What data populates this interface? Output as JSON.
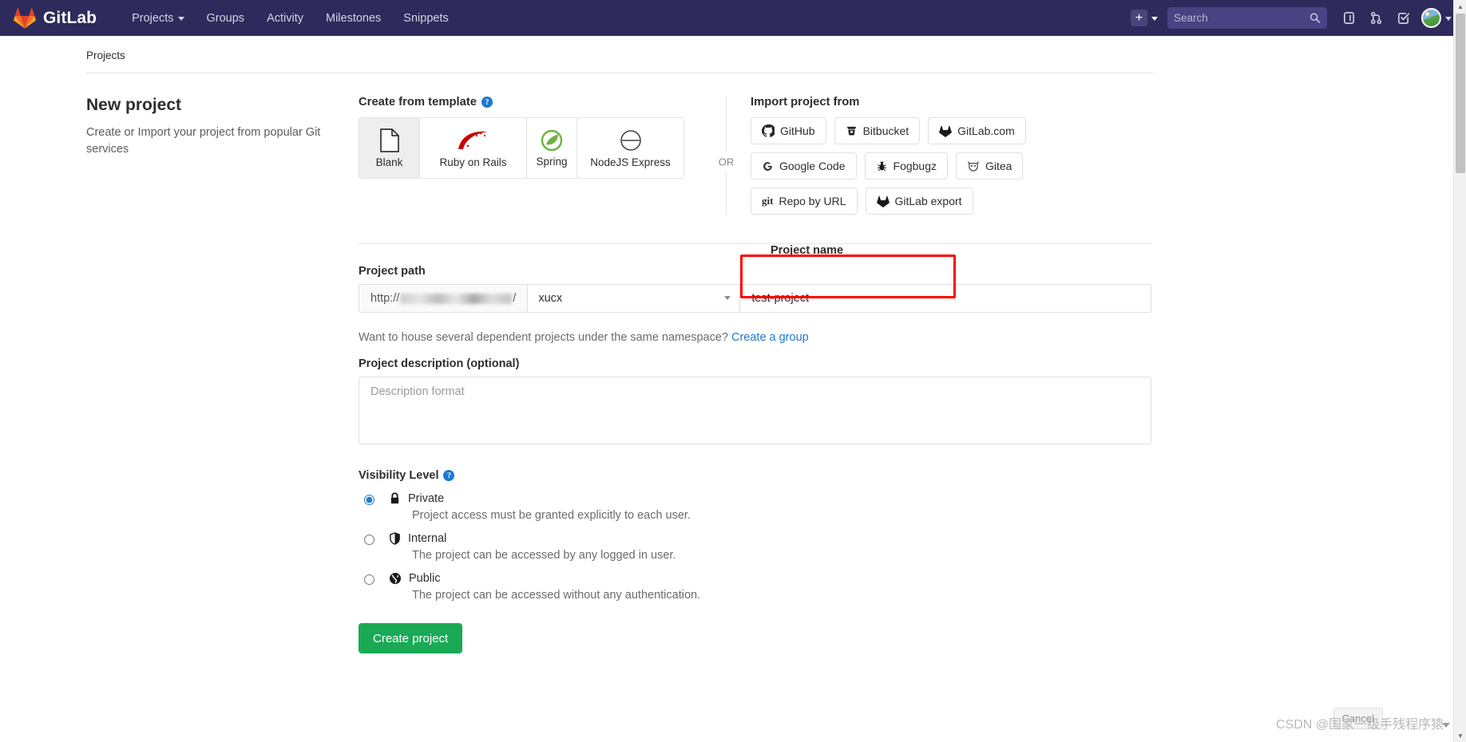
{
  "navbar": {
    "brand": "GitLab",
    "logo_icon": "gitlab-fox-logo",
    "links": [
      {
        "label": "Projects",
        "has_caret": true
      },
      {
        "label": "Groups",
        "has_caret": false
      },
      {
        "label": "Activity",
        "has_caret": false
      },
      {
        "label": "Milestones",
        "has_caret": false
      },
      {
        "label": "Snippets",
        "has_caret": false
      }
    ],
    "plus_label": "+",
    "search_placeholder": "Search",
    "search_value": "",
    "icons": [
      "issues-icon",
      "merge-requests-icon",
      "todos-icon"
    ],
    "avatar_icon": "user-avatar"
  },
  "breadcrumb": {
    "items": [
      "Projects"
    ]
  },
  "left": {
    "title": "New project",
    "subtitle": "Create or Import your project from popular Git services"
  },
  "templates": {
    "section_title": "Create from template",
    "help_icon": "?",
    "items": [
      {
        "label": "Blank",
        "icon": "blank-file-icon",
        "selected": true
      },
      {
        "label": "Ruby on Rails",
        "icon": "rails-icon",
        "selected": false
      },
      {
        "label": "Spring",
        "icon": "spring-leaf-icon",
        "selected": false
      },
      {
        "label": "NodeJS Express",
        "icon": "express-icon",
        "selected": false
      }
    ]
  },
  "or_divider": "OR",
  "import": {
    "section_title": "Import project from",
    "buttons": [
      {
        "label": "GitHub",
        "icon": "github-icon"
      },
      {
        "label": "Bitbucket",
        "icon": "bitbucket-icon"
      },
      {
        "label": "GitLab.com",
        "icon": "gitlab-icon"
      },
      {
        "label": "Google Code",
        "icon": "google-icon"
      },
      {
        "label": "Fogbugz",
        "icon": "fogbugz-bug-icon"
      },
      {
        "label": "Gitea",
        "icon": "gitea-icon"
      },
      {
        "label": "Repo by URL",
        "icon": "git-text-icon"
      },
      {
        "label": "GitLab export",
        "icon": "gitlab-icon"
      }
    ]
  },
  "form": {
    "path_label": "Project path",
    "path_prefix_scheme": "http://",
    "path_prefix_suffix": "/",
    "namespace_value": "xucx",
    "name_label": "Project name",
    "name_value": "test-project",
    "name_placeholder": "",
    "namespace_hint": "Want to house several dependent projects under the same namespace?",
    "namespace_link": "Create a group",
    "description_label": "Project description (optional)",
    "description_value": "",
    "description_placeholder": "Description format",
    "visibility_label": "Visibility Level",
    "visibility_help_icon": "?",
    "visibility_options": [
      {
        "name": "Private",
        "icon": "lock-icon",
        "description": "Project access must be granted explicitly to each user.",
        "selected": true
      },
      {
        "name": "Internal",
        "icon": "shield-icon",
        "description": "The project can be accessed by any logged in user.",
        "selected": false
      },
      {
        "name": "Public",
        "icon": "globe-icon",
        "description": "The project can be accessed without any authentication.",
        "selected": false
      }
    ],
    "submit_label": "Create project"
  },
  "overlay": {
    "highlight_color": "#ff0000",
    "tooltip_text": "Cancel",
    "watermark": "CSDN @国家一级手残程序猿"
  },
  "theme": {
    "navbar_bg": "#2e2a5b",
    "primary_button": "#1aaa55",
    "link_color": "#1f78d1"
  }
}
